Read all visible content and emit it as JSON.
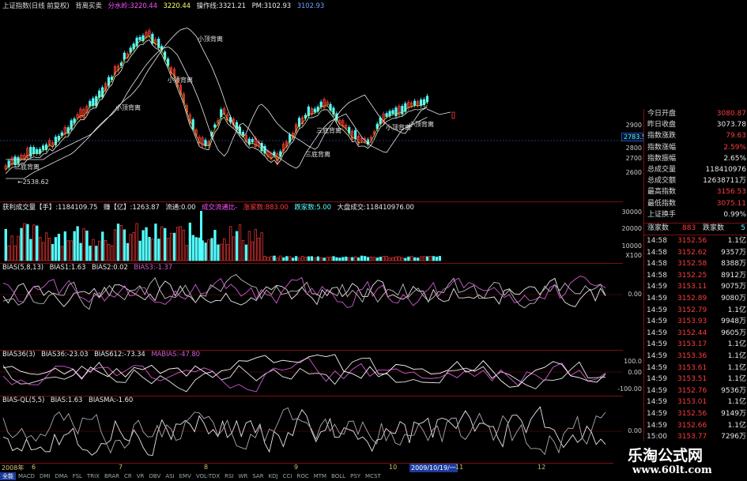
{
  "header": {
    "title": "上证指数(日线 前复权)",
    "indicator": "背离买卖",
    "labels": [
      "分水岭:3220.44",
      "3220.44",
      "操作线:3321.21",
      "PM:3102.93",
      "3102.93"
    ],
    "extra_label": "2783.5",
    "low_label": "←2538.62"
  },
  "main_annotations": [
    "小顶背离",
    "小顶背离",
    "小顶背离",
    "三底背离",
    "三底背离",
    "三底背离",
    "小顶背离",
    "小顶背离",
    "小顶背离"
  ],
  "main_yaxis": [
    "2900",
    "2800",
    "2700",
    "2600"
  ],
  "volume": {
    "labels": [
      "获利成交量【手】:1184109.75",
      "赚【亿】:1263.87",
      "流通:0.00",
      "成交流通比-",
      "涨家数:883.00",
      "跌家数:5.00",
      "大盘成交:118410976.00"
    ],
    "yaxis": [
      "30000",
      "20000",
      "10000",
      "X100"
    ]
  },
  "bias": {
    "labels": [
      "BIAS(5,8,13)",
      "BIAS1:1.63",
      "BIAS2:0.02",
      "BIAS3:-1.37"
    ],
    "yaxis": [
      "0.00"
    ]
  },
  "bias36": {
    "labels": [
      "BIAS36(3)",
      "BIAS36:-23.03",
      "BIAS612:-73.34",
      "MABIAS:-47.80"
    ],
    "yaxis": [
      "100.0",
      "0.00",
      "-100.00"
    ]
  },
  "biasql": {
    "labels": [
      "BIAS-QL(5,5)",
      "BIAS:1.63",
      "BIASMA:-1.60"
    ],
    "yaxis": [
      "0.00"
    ]
  },
  "xaxis": {
    "labels": [
      "2008年",
      "6",
      "7",
      "8",
      "9",
      "10",
      "11",
      "12"
    ],
    "cursor": "2009/10/19/一"
  },
  "tabs": [
    "全能",
    "MACD",
    "DMI",
    "DMA",
    "FSL",
    "TRIX",
    "BRAR",
    "CR",
    "VR",
    "OBV",
    "ASI",
    "EMV",
    "VOL-TDX",
    "RSI",
    "WR",
    "SAR",
    "KDJ",
    "CCI",
    "ROC",
    "MTM",
    "BOLL",
    "PSY",
    "MCST"
  ],
  "sidebar": {
    "stats": [
      {
        "k": "今日开盘",
        "v": "3080.87",
        "c": "#ff3b3b"
      },
      {
        "k": "昨日收盘",
        "v": "3073.78",
        "c": "#e8e8e8"
      },
      {
        "k": "指数涨跌",
        "v": "79.63",
        "c": "#ff3b3b"
      },
      {
        "k": "指数涨幅",
        "v": "2.59%",
        "c": "#ff3b3b"
      },
      {
        "k": "指数振幅",
        "v": "2.65%",
        "c": "#e8e8e8"
      },
      {
        "k": "总成交量",
        "v": "118410976",
        "c": "#e8e8e8"
      },
      {
        "k": "总成交额",
        "v": "12638711万",
        "c": "#e8e8e8"
      },
      {
        "k": "最高指数",
        "v": "3156.53",
        "c": "#ff3b3b"
      },
      {
        "k": "最低指数",
        "v": "3075.11",
        "c": "#ff3b3b"
      },
      {
        "k": "上证换手",
        "v": "0.99%",
        "c": "#e8e8e8"
      }
    ],
    "up_label": "涨家数",
    "up_value": "883",
    "down_label": "跌家数",
    "down_value": "5",
    "ticks": [
      {
        "t": "14:58",
        "p": "3152.56",
        "v": "1.1亿"
      },
      {
        "t": "14:58",
        "p": "3152.62",
        "v": "9357万"
      },
      {
        "t": "14:58",
        "p": "3152.58",
        "v": "8388万"
      },
      {
        "t": "14:58",
        "p": "3152.25",
        "v": "8912万"
      },
      {
        "t": "14:59",
        "p": "3153.11",
        "v": "9075万"
      },
      {
        "t": "14:59",
        "p": "3152.89",
        "v": "9080万"
      },
      {
        "t": "14:59",
        "p": "3152.79",
        "v": "1.1亿"
      },
      {
        "t": "14:59",
        "p": "3153.93",
        "v": "9948万"
      },
      {
        "t": "14:59",
        "p": "3152.44",
        "v": "9605万"
      },
      {
        "t": "14:59",
        "p": "3153.17",
        "v": "1.1亿"
      },
      {
        "t": "14:59",
        "p": "3153.36",
        "v": "1.1亿"
      },
      {
        "t": "14:59",
        "p": "3153.61",
        "v": "1.1亿"
      },
      {
        "t": "14:59",
        "p": "3153.51",
        "v": "1.1亿"
      },
      {
        "t": "14:59",
        "p": "3152.76",
        "v": "9536万"
      },
      {
        "t": "14:59",
        "p": "3153.01",
        "v": "1.1亿"
      },
      {
        "t": "14:59",
        "p": "3152.56",
        "v": "9149万"
      },
      {
        "t": "14:59",
        "p": "3152.66",
        "v": "1.1亿"
      },
      {
        "t": "15:00",
        "p": "3153.77",
        "v": "7296万"
      }
    ]
  },
  "watermark": {
    "line1": "乐淘公式网",
    "line2": "www.60lt.com"
  },
  "colors": {
    "up": "#ff3b3b",
    "down": "#54ffff",
    "grid": "#7a1010",
    "bias_white": "#e8e8e8",
    "bias_magenta": "#d05cd0"
  }
}
